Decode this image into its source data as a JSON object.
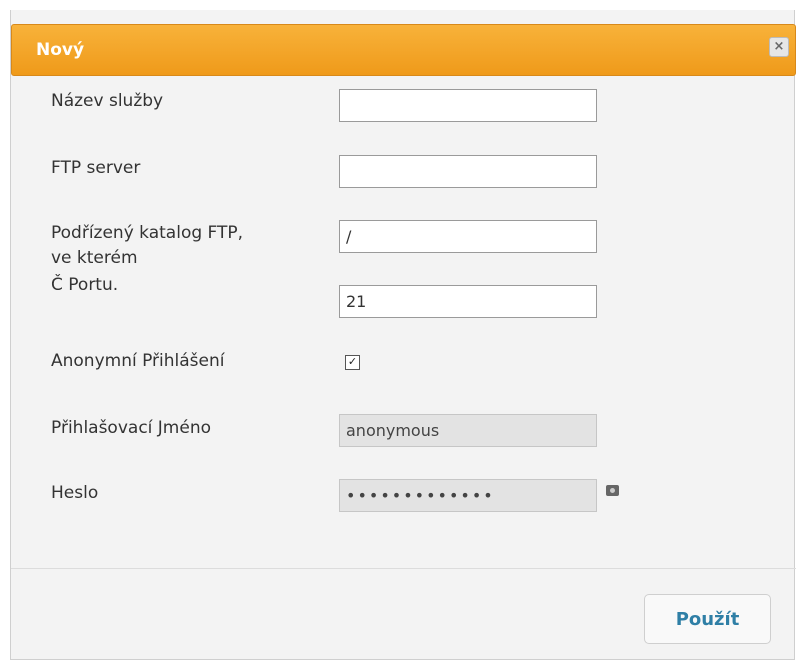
{
  "dialog": {
    "title": "Nový",
    "close_label": "×",
    "apply_label": "Použít"
  },
  "form": {
    "service_name_label": "Název služby",
    "service_name_value": "",
    "ftp_server_label": "FTP server",
    "ftp_server_value": "",
    "subdir_label_line1": "Podřízený katalog FTP,",
    "subdir_label_line2": "ve kterém",
    "subdir_value": "/",
    "port_label": "Č Portu.",
    "port_value": "21",
    "anonymous_label": "Anonymní Přihlášení",
    "anonymous_checked": true,
    "anonymous_mark": "✓",
    "username_label": "Přihlašovací Jméno",
    "username_value": "anonymous",
    "password_label": "Heslo",
    "password_value": "•••••••••••••"
  },
  "colors": {
    "titlebar": "#f0a020",
    "apply_text": "#2f7fa6"
  }
}
